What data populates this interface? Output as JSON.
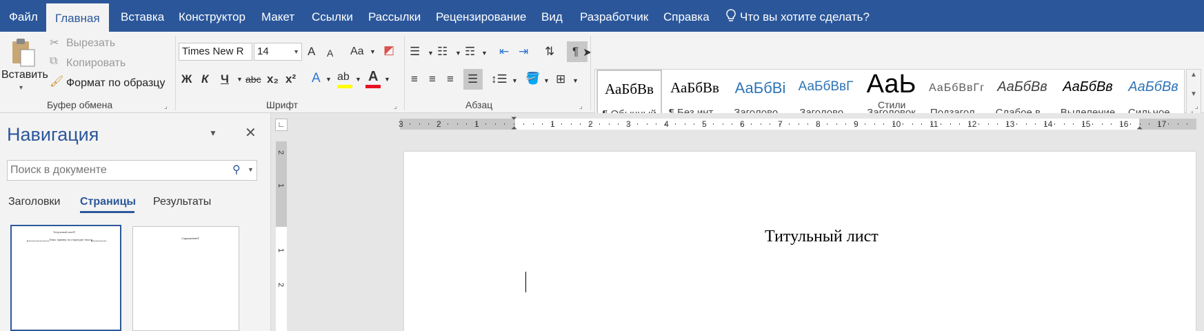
{
  "menu": {
    "tabs": [
      "Файл",
      "Главная",
      "Вставка",
      "Конструктор",
      "Макет",
      "Ссылки",
      "Рассылки",
      "Рецензирование",
      "Вид",
      "Разработчик",
      "Справка"
    ],
    "tell_me": "Что вы хотите сделать?"
  },
  "clipboard": {
    "paste": "Вставить",
    "cut": "Вырезать",
    "copy": "Копировать",
    "format_painter": "Формат по образцу",
    "label": "Буфер обмена"
  },
  "font": {
    "name": "Times New R",
    "size": "14",
    "bold": "Ж",
    "italic": "К",
    "underline": "Ч",
    "strike": "abc",
    "subscript": "x₂",
    "superscript": "x²",
    "grow": "A",
    "shrink": "A",
    "case": "Aa",
    "label": "Шрифт"
  },
  "paragraph": {
    "label": "Абзац",
    "pilcrow": "¶"
  },
  "styles": {
    "label": "Стили",
    "items": [
      {
        "sample": "АаБбВв",
        "name": "¶ Обычный"
      },
      {
        "sample": "АаБбВв",
        "name": "¶ Без инт..."
      },
      {
        "sample": "АаБбВі",
        "name": "Заголово..."
      },
      {
        "sample": "АаБбВвГ",
        "name": "Заголово..."
      },
      {
        "sample": "АаЬ",
        "name": "Заголовок"
      },
      {
        "sample": "АаБбВвГг",
        "name": "Подзагол..."
      },
      {
        "sample": "АаБбВв",
        "name": "Слабое в..."
      },
      {
        "sample": "АаБбВв",
        "name": "Выделение"
      },
      {
        "sample": "АаБбВв",
        "name": "Сильное..."
      }
    ]
  },
  "nav": {
    "title": "Навигация",
    "search_placeholder": "Поиск в документе",
    "tabs": [
      "Заголовки",
      "Страницы",
      "Результаты"
    ],
    "thumb1_title": "Титульный лист¶",
    "thumb1_line": "Тема: пример по структуре текста",
    "thumb2_title": "Содержание¶"
  },
  "ruler": {
    "h_ticks": [
      "3",
      "2",
      "1",
      "1",
      "2",
      "3",
      "4",
      "5",
      "6",
      "7",
      "8",
      "9",
      "10",
      "11",
      "12",
      "13",
      "14",
      "15",
      "16",
      "17"
    ],
    "v_ticks": [
      "2",
      "1",
      "1",
      "2"
    ]
  },
  "document": {
    "title": "Титульный лист"
  },
  "colors": {
    "brand": "#2b579a",
    "highlight": "#ffff00",
    "font_color": "#e81123"
  }
}
